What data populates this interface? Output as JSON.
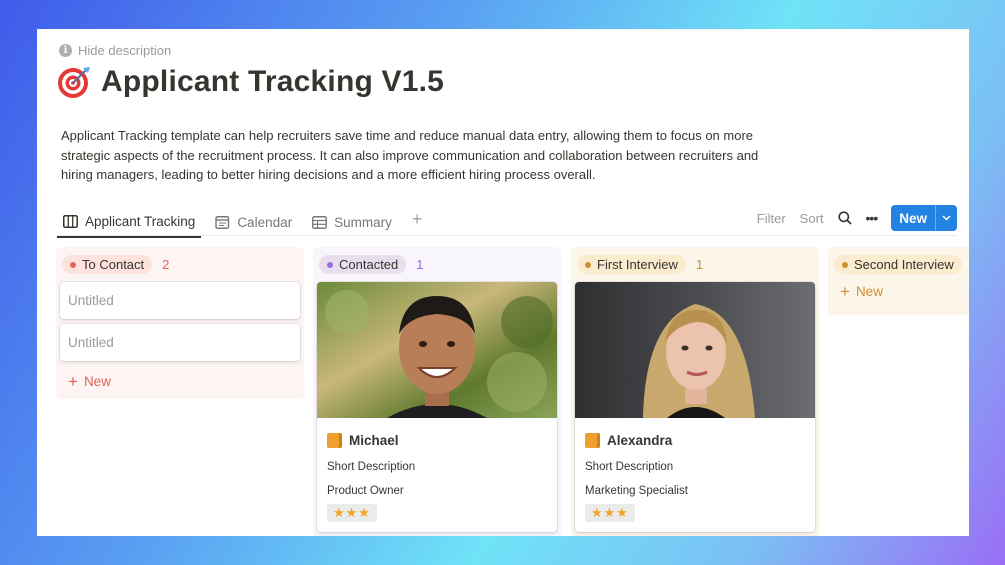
{
  "hide_description": "Hide description",
  "page": {
    "title": "Applicant Tracking V1.5",
    "description": "Applicant Tracking template can help recruiters save time and reduce manual data entry, allowing them to focus on more strategic aspects of the recruitment process. It can also improve communication and collaboration between recruiters and hiring managers, leading to better hiring decisions and a more efficient hiring process overall."
  },
  "tabs": [
    {
      "label": "Applicant Tracking",
      "icon": "board-icon",
      "active": true
    },
    {
      "label": "Calendar",
      "icon": "calendar-icon",
      "active": false
    },
    {
      "label": "Summary",
      "icon": "table-icon",
      "active": false
    }
  ],
  "toolbar": {
    "filter": "Filter",
    "sort": "Sort",
    "new": "New"
  },
  "columns": [
    {
      "name": "To Contact",
      "count": "2",
      "color": "#e16259",
      "bg": "#fdf5f3",
      "pill_bg": "#fde2dd",
      "cards": [
        "Untitled",
        "Untitled"
      ],
      "new_label": "New"
    },
    {
      "name": "Contacted",
      "count": "1",
      "color": "#9a6dd7",
      "bg": "#f8f5fc",
      "pill_bg": "#e8deee"
    },
    {
      "name": "First Interview",
      "count": "1",
      "color": "#cb912f",
      "bg": "#fbf5ea",
      "pill_bg": "#fbeccf"
    },
    {
      "name": "Second Interview",
      "count": "",
      "color": "#cb912f",
      "bg": "#fbf5ea",
      "pill_bg": "#fbeccf",
      "new_label": "New"
    }
  ],
  "candidates": [
    {
      "name": "Michael",
      "short_description": "Short Description",
      "role": "Product Owner",
      "rating": "★★★"
    },
    {
      "name": "Alexandra",
      "short_description": "Short Description",
      "role": "Marketing Specialist",
      "rating": "★★★"
    }
  ]
}
